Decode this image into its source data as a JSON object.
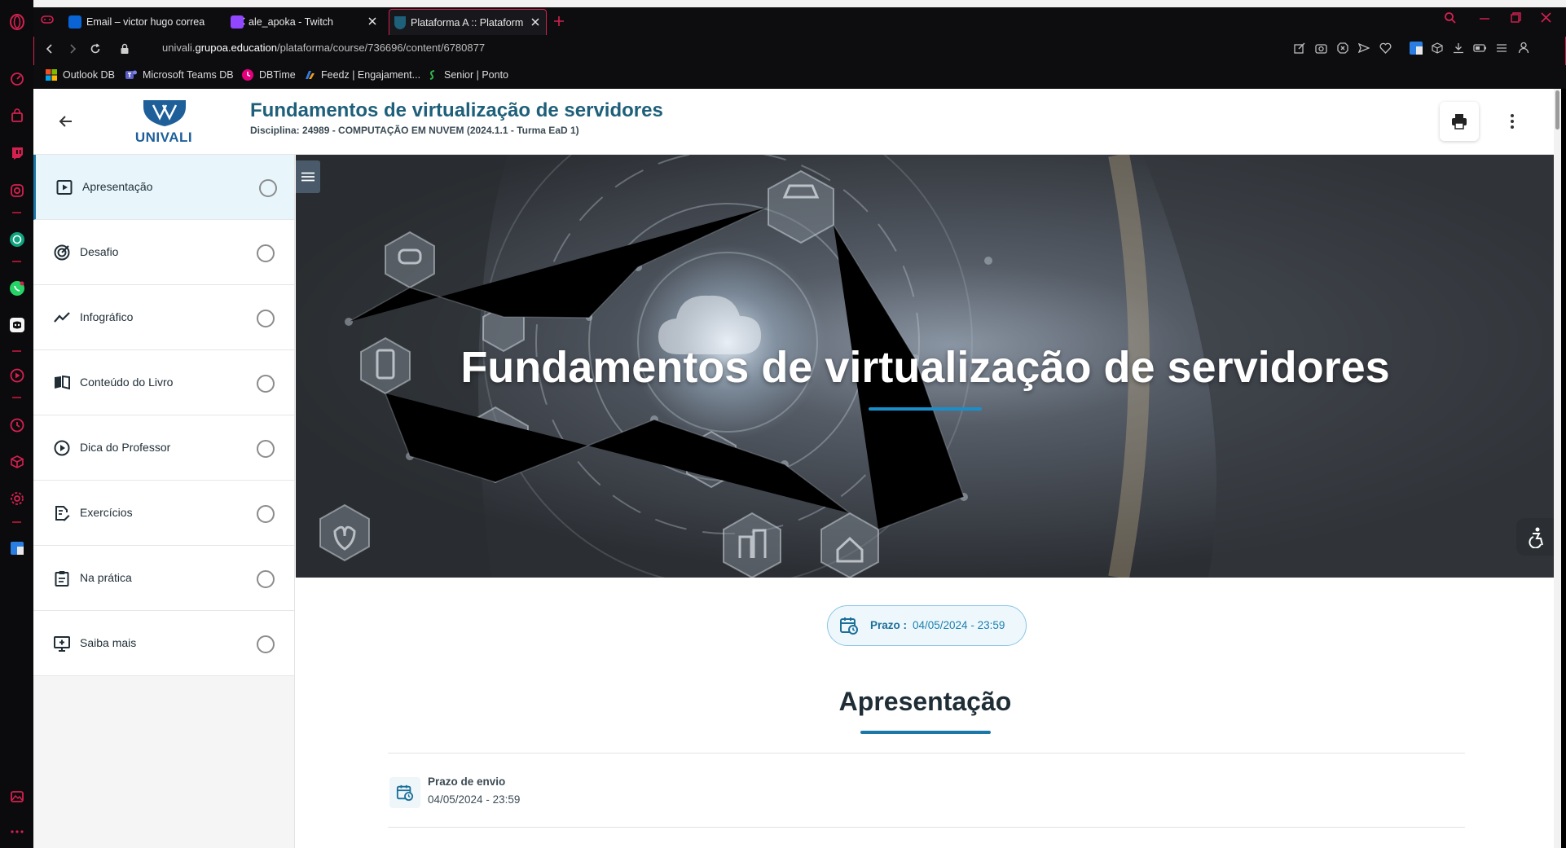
{
  "browser": {
    "tabs": [
      {
        "title": "Email – victor hugo correa",
        "favicon_color": "#0a64d6"
      },
      {
        "title": "ale_apoka - Twitch",
        "favicon_color": "#9146ff"
      },
      {
        "title": "Plataforma A :: Plataforma",
        "favicon_color": "#1e5f7a"
      }
    ],
    "url": {
      "prefix": "univali.",
      "domain": "grupoa.education",
      "path": "/plataforma/course/736696/content/6780877"
    },
    "bookmarks": [
      {
        "label": "Outlook DB",
        "icon": "windows-icon"
      },
      {
        "label": "Microsoft Teams DB",
        "icon": "teams-icon"
      },
      {
        "label": "DBTime",
        "icon": "clock-icon"
      },
      {
        "label": "Feedz | Engajament...",
        "icon": "feedz-icon"
      },
      {
        "label": "Senior | Ponto",
        "icon": "senior-icon"
      }
    ],
    "accent_color": "#d4204f"
  },
  "header": {
    "logo_text": "UNIVALI",
    "course_title": "Fundamentos de virtualização de servidores",
    "discipline": "Disciplina: 24989 - COMPUTAÇÃO EM NUVEM (2024.1.1 - Turma EaD 1)"
  },
  "nav": {
    "items": [
      {
        "label": "Apresentação",
        "icon": "play-square-icon",
        "active": true
      },
      {
        "label": "Desafio",
        "icon": "target-icon"
      },
      {
        "label": "Infográfico",
        "icon": "trend-line-icon"
      },
      {
        "label": "Conteúdo do Livro",
        "icon": "book-icon"
      },
      {
        "label": "Dica do Professor",
        "icon": "play-circle-icon"
      },
      {
        "label": "Exercícios",
        "icon": "edit-document-icon"
      },
      {
        "label": "Na prática",
        "icon": "clipboard-icon"
      },
      {
        "label": "Saiba mais",
        "icon": "monitor-plus-icon"
      }
    ]
  },
  "hero": {
    "title": "Fundamentos de virtualização de servidores"
  },
  "deadline": {
    "label": "Prazo :",
    "value": "04/05/2024 - 23:59"
  },
  "section": {
    "title": "Apresentação",
    "submit_label": "Prazo de envio",
    "submit_value": "04/05/2024 - 23:59"
  },
  "colors": {
    "primary": "#1b77a8",
    "title": "#1e5f7a",
    "active_bg": "#e8f6fc"
  }
}
